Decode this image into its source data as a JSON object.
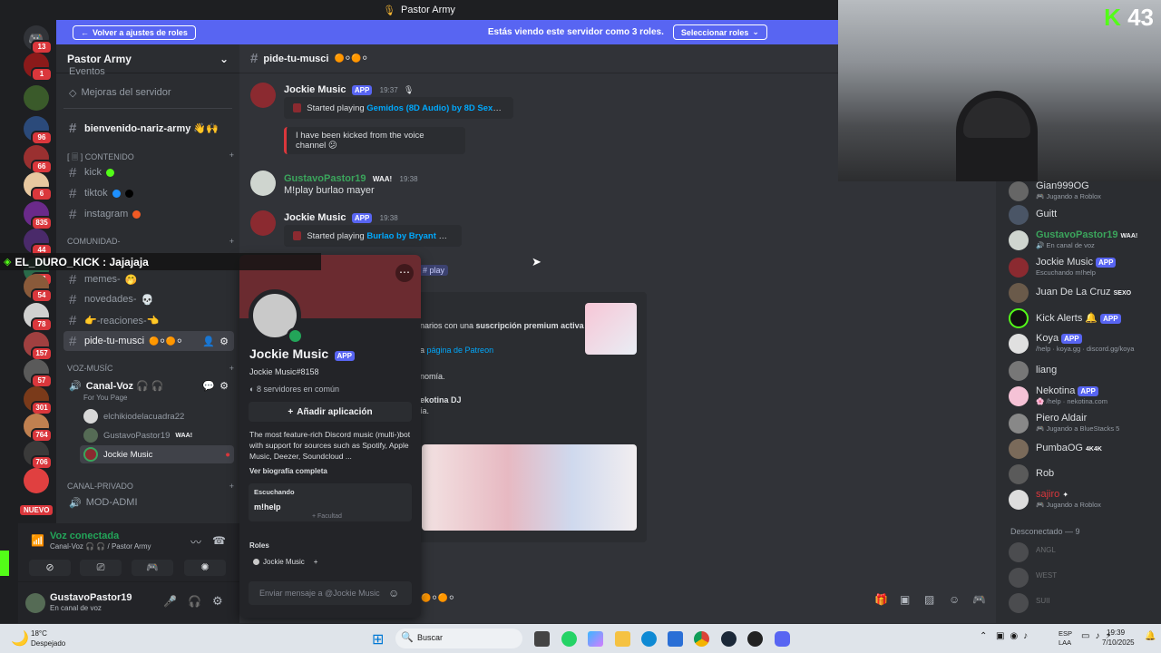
{
  "window": {
    "title": "Pastor Army"
  },
  "banner": {
    "back_label": "Volver a ajustes de roles",
    "viewing_text": "Estás viendo este servidor como 3 roles.",
    "select_label": "Seleccionar roles"
  },
  "rail": {
    "badges": [
      "13",
      "1",
      "96",
      "66",
      "6",
      "835",
      "44",
      "28",
      "54",
      "78",
      "157",
      "57",
      "301",
      "764",
      "706"
    ],
    "new_label": "NUEVO"
  },
  "sidebar": {
    "server_name": "Pastor Army",
    "events_label": "Eventos",
    "boost_label": "Mejoras del servidor",
    "channels": {
      "bienvenido": "bienvenido-nariz-army 👋🙌",
      "kick": "kick",
      "tiktok": "tiktok",
      "instagram": "instagram",
      "memes": "memes-",
      "novedades": "novedades-",
      "reaciones": "👉-reaciones-👈",
      "pide": "pide-tu-musci",
      "canal_voz": "Canal-Voz 🎧 🎧",
      "mod_admi": "MOD-ADMI"
    },
    "categories": {
      "contenido": "[ 🗏 ] CONTENIDO",
      "comunidad": "COMUNIDAD-",
      "voz": "Voz-musíc",
      "privado": "CANAL-PRIVADO"
    },
    "for_you_page": "For You Page",
    "voice_users": [
      "elchikiodelacuadra22",
      "GustavoPastor19",
      "Jockie Music"
    ],
    "waa_tag": "WAA!"
  },
  "voice_panel": {
    "status": "Voz conectada",
    "location": "Canal-Voz 🎧 🎧 / Pastor Army"
  },
  "user_panel": {
    "name": "GustavoPastor19",
    "status": "En canal de voz"
  },
  "chat": {
    "channel_name": "pide-tu-musci",
    "messages": [
      {
        "author": "Jockie Music",
        "tag": "APP",
        "time": "19:37",
        "embed_prefix": "Started playing",
        "embed_link": "Gemidos (8D Audio) by 8D Sexy Girls",
        "embed2": "I have been kicked from the voice channel 😕"
      },
      {
        "author": "GustavoPastor19",
        "tag": "WAA!",
        "time": "19:38",
        "text": "M!play burlao mayer"
      },
      {
        "author": "Jockie Music",
        "tag": "APP",
        "time": "19:38",
        "embed_prefix": "Started playing",
        "embed_link": "Burlao by Bryant Myers"
      }
    ],
    "command_chip": "# play",
    "premium_embed": {
      "line1_pre": "narios con una ",
      "line1_bold": "suscripción premium activa",
      "line2_pre": "a ",
      "line2_link": "página de Patreon",
      "line3": "nomía.",
      "line4": "ekotina DJ",
      "line5": "ía."
    }
  },
  "popup": {
    "name": "Jockie Music",
    "tag": "APP",
    "username": "Jockie Music#8158",
    "mutual": "8 servidores en común",
    "add_app": "Añadir aplicación",
    "bio": "The most feature-rich Discord music (multi-)bot with support for sources such as Spotify, Apple Music, Deezer, Soundcloud ...",
    "bio_link": "Ver biografía completa",
    "listening_label": "Escuchando",
    "listening_value": "m!help",
    "listening_sub": "+ Facultad",
    "roles_label": "Roles",
    "role": "Jockie Music",
    "message_placeholder": "Enviar mensaje a @Jockie Music"
  },
  "members": [
    {
      "name": "Gian999OG",
      "status": "Jugando a Roblox"
    },
    {
      "name": "Guitt",
      "status": ""
    },
    {
      "name": "GustavoPastor19",
      "status": "En canal de voz",
      "tag": "WAA!"
    },
    {
      "name": "Jockie Music",
      "status": "Escuchando m!help",
      "tag": "APP"
    },
    {
      "name": "Juan De La Cruz",
      "status": "",
      "tag": "SEXO"
    },
    {
      "name": "Kick Alerts",
      "status": "",
      "tag": "APP"
    },
    {
      "name": "Koya",
      "status": "/help · koya.gg · discord.gg/koya",
      "tag": "APP"
    },
    {
      "name": "liang",
      "status": ""
    },
    {
      "name": "Nekotina",
      "status": "/help · nekotina.com",
      "tag": "APP"
    },
    {
      "name": "Piero Aldair",
      "status": "Jugando a BlueStacks 5"
    },
    {
      "name": "PumbaOG",
      "status": "",
      "tag": "4K4K"
    },
    {
      "name": "Rob",
      "status": ""
    },
    {
      "name": "sajiro",
      "status": "Jugando a Roblox"
    }
  ],
  "members_offline_header": "Desconectado — 9",
  "members_offline": [
    "ANGL",
    "WEST",
    "SUII"
  ],
  "overlay": {
    "kick_text": "EL_DURO_KICK : Jajajaja"
  },
  "webcam": {
    "score": "43",
    "logo_letter": "K"
  },
  "taskbar": {
    "weather_temp": "18°C",
    "weather_desc": "Despejado",
    "search_placeholder": "Buscar",
    "lang1": "ESP",
    "lang2": "LAA",
    "time": "19:39",
    "date": "7/10/2025"
  },
  "colors": {
    "accent": "#5865f2",
    "green_user": "#3ba55c",
    "link": "#00a8fc",
    "kick_green": "#53fc18"
  }
}
